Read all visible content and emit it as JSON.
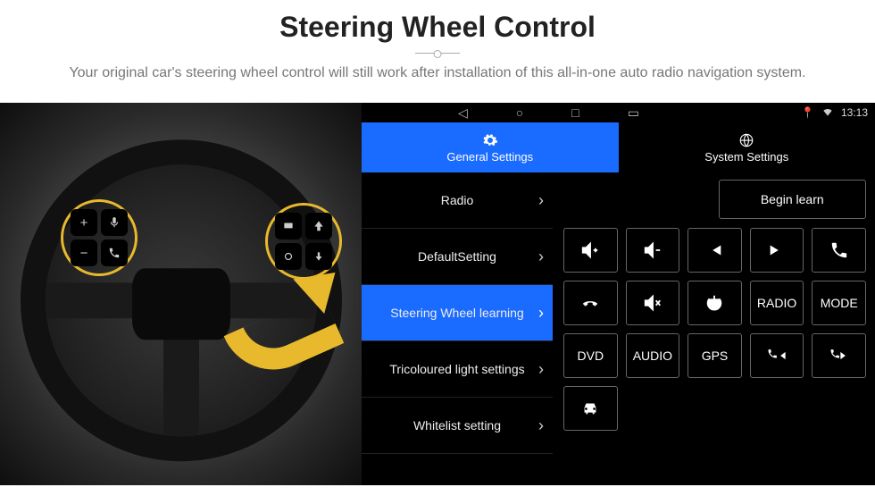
{
  "header": {
    "title": "Steering Wheel Control",
    "subtitle": "Your original car's steering wheel control will still work after installation of this all-in-one auto radio navigation system."
  },
  "status": {
    "time": "13:13"
  },
  "tabs": {
    "general": "General Settings",
    "system": "System Settings"
  },
  "menu": {
    "radio": "Radio",
    "default": "DefaultSetting",
    "swl": "Steering Wheel learning",
    "tri": "Tricoloured light settings",
    "white": "Whitelist setting"
  },
  "panel": {
    "begin": "Begin learn",
    "radio": "RADIO",
    "mode": "MODE",
    "dvd": "DVD",
    "audio": "AUDIO",
    "gps": "GPS"
  },
  "wheel": {
    "plus": "+",
    "minus": "−"
  }
}
